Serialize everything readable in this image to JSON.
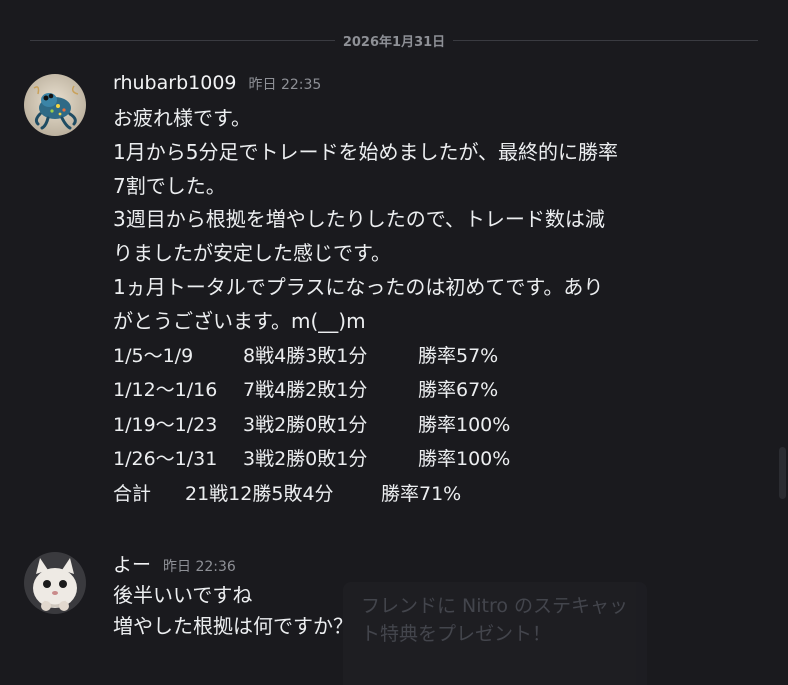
{
  "date_divider": "2026年1月31日",
  "messages": [
    {
      "username": "rhubarb1009",
      "timestamp": "昨日 22:35",
      "lines": [
        "お疲れ様です。",
        "1月から5分足でトレードを始めましたが、最終的に勝率",
        "7割でした。",
        "3週目から根拠を増やしたりしたので、トレード数は減",
        "りましたが安定した感じです。",
        "1ヵ月トータルでプラスになったのは初めてです。あり",
        "がとうございます。m(__)m"
      ],
      "stats": [
        {
          "period": "1/5〜1/9",
          "record": "8戦4勝3敗1分",
          "rate": "勝率57%"
        },
        {
          "period": "1/12〜1/16",
          "record": "7戦4勝2敗1分",
          "rate": "勝率67%"
        },
        {
          "period": "1/19〜1/23",
          "record": "3戦2勝0敗1分",
          "rate": "勝率100%"
        },
        {
          "period": "1/26〜1/31",
          "record": "3戦2勝0敗1分",
          "rate": "勝率100%"
        }
      ],
      "total": {
        "label": "合計",
        "record": "21戦12勝5敗4分",
        "rate": "勝率71%"
      }
    },
    {
      "username": "よー",
      "timestamp": "昨日 22:36",
      "lines": [
        "後半いいですね",
        "増やした根拠は何ですか？"
      ]
    }
  ],
  "promo": {
    "text": "フレンドに Nitro のステキャット特典をプレゼント！"
  },
  "colors": {
    "background": "#1a1a1e",
    "text": "#eceef0",
    "muted": "#8e9096"
  }
}
